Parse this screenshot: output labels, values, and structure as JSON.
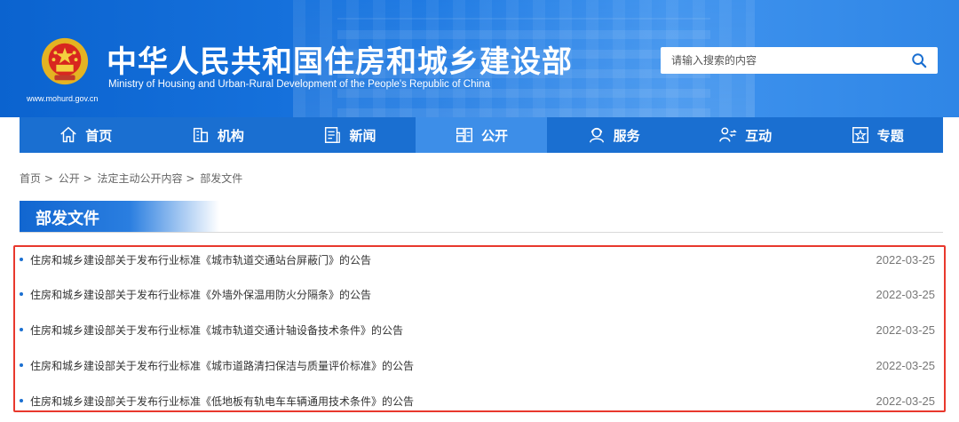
{
  "header": {
    "title_cn": "中华人民共和国住房和城乡建设部",
    "title_en": "Ministry of Housing and Urban-Rural Development of the People's Republic of China",
    "site_url": "www.mohurd.gov.cn",
    "emblem_icon": "national-emblem-icon",
    "search": {
      "placeholder": "请输入搜索的内容",
      "value": "",
      "icon": "search-icon"
    }
  },
  "nav": {
    "items": [
      {
        "label": "首页",
        "icon": "home-icon",
        "active": false
      },
      {
        "label": "机构",
        "icon": "building-icon",
        "active": false
      },
      {
        "label": "新闻",
        "icon": "news-icon",
        "active": false
      },
      {
        "label": "公开",
        "icon": "disclosure-icon",
        "active": true
      },
      {
        "label": "服务",
        "icon": "service-icon",
        "active": false
      },
      {
        "label": "互动",
        "icon": "interaction-icon",
        "active": false
      },
      {
        "label": "专题",
        "icon": "star-icon",
        "active": false
      }
    ]
  },
  "breadcrumb": {
    "items": [
      "首页",
      "公开",
      "法定主动公开内容",
      "部发文件"
    ],
    "separator": ">"
  },
  "section": {
    "title": "部发文件"
  },
  "documents": [
    {
      "title": "住房和城乡建设部关于发布行业标准《城市轨道交通站台屏蔽门》的公告",
      "date": "2022-03-25"
    },
    {
      "title": "住房和城乡建设部关于发布行业标准《外墙外保温用防火分隔条》的公告",
      "date": "2022-03-25"
    },
    {
      "title": "住房和城乡建设部关于发布行业标准《城市轨道交通计轴设备技术条件》的公告",
      "date": "2022-03-25"
    },
    {
      "title": "住房和城乡建设部关于发布行业标准《城市道路清扫保洁与质量评价标准》的公告",
      "date": "2022-03-25"
    },
    {
      "title": "住房和城乡建设部关于发布行业标准《低地板有轨电车车辆通用技术条件》的公告",
      "date": "2022-03-25"
    }
  ],
  "colors": {
    "brand_blue": "#1a6fd1",
    "nav_active": "#3d8ee8",
    "highlight_border": "#e8382d"
  }
}
